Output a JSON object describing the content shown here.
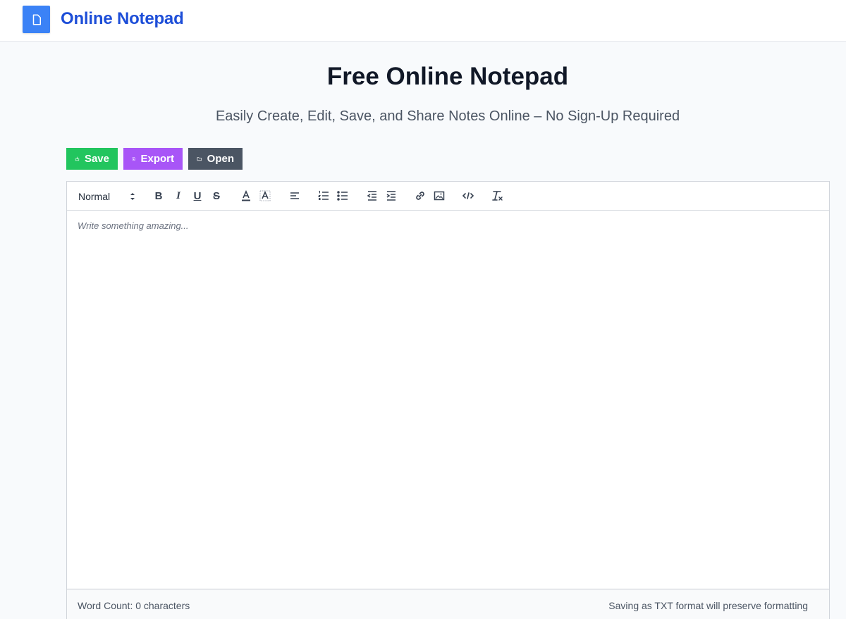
{
  "app": {
    "brand": "Online Notepad"
  },
  "hero": {
    "title": "Free Online Notepad",
    "subtitle": "Easily Create, Edit, Save, and Share Notes Online – No Sign-Up Required"
  },
  "actions": {
    "save_label": "Save",
    "export_label": "Export",
    "open_label": "Open"
  },
  "toolbar": {
    "header_selected": "Normal",
    "bold": "B",
    "italic": "I",
    "underline": "U",
    "strike": "S"
  },
  "editor": {
    "placeholder": "Write something amazing..."
  },
  "footer": {
    "word_count": "Word Count: 0 characters",
    "format_note": "Saving as TXT format will preserve formatting"
  },
  "colors": {
    "brand": "#1d4ed8",
    "logo_bg": "#3b82f6",
    "save": "#22c55e",
    "export": "#a855f7",
    "open": "#4b5563"
  }
}
